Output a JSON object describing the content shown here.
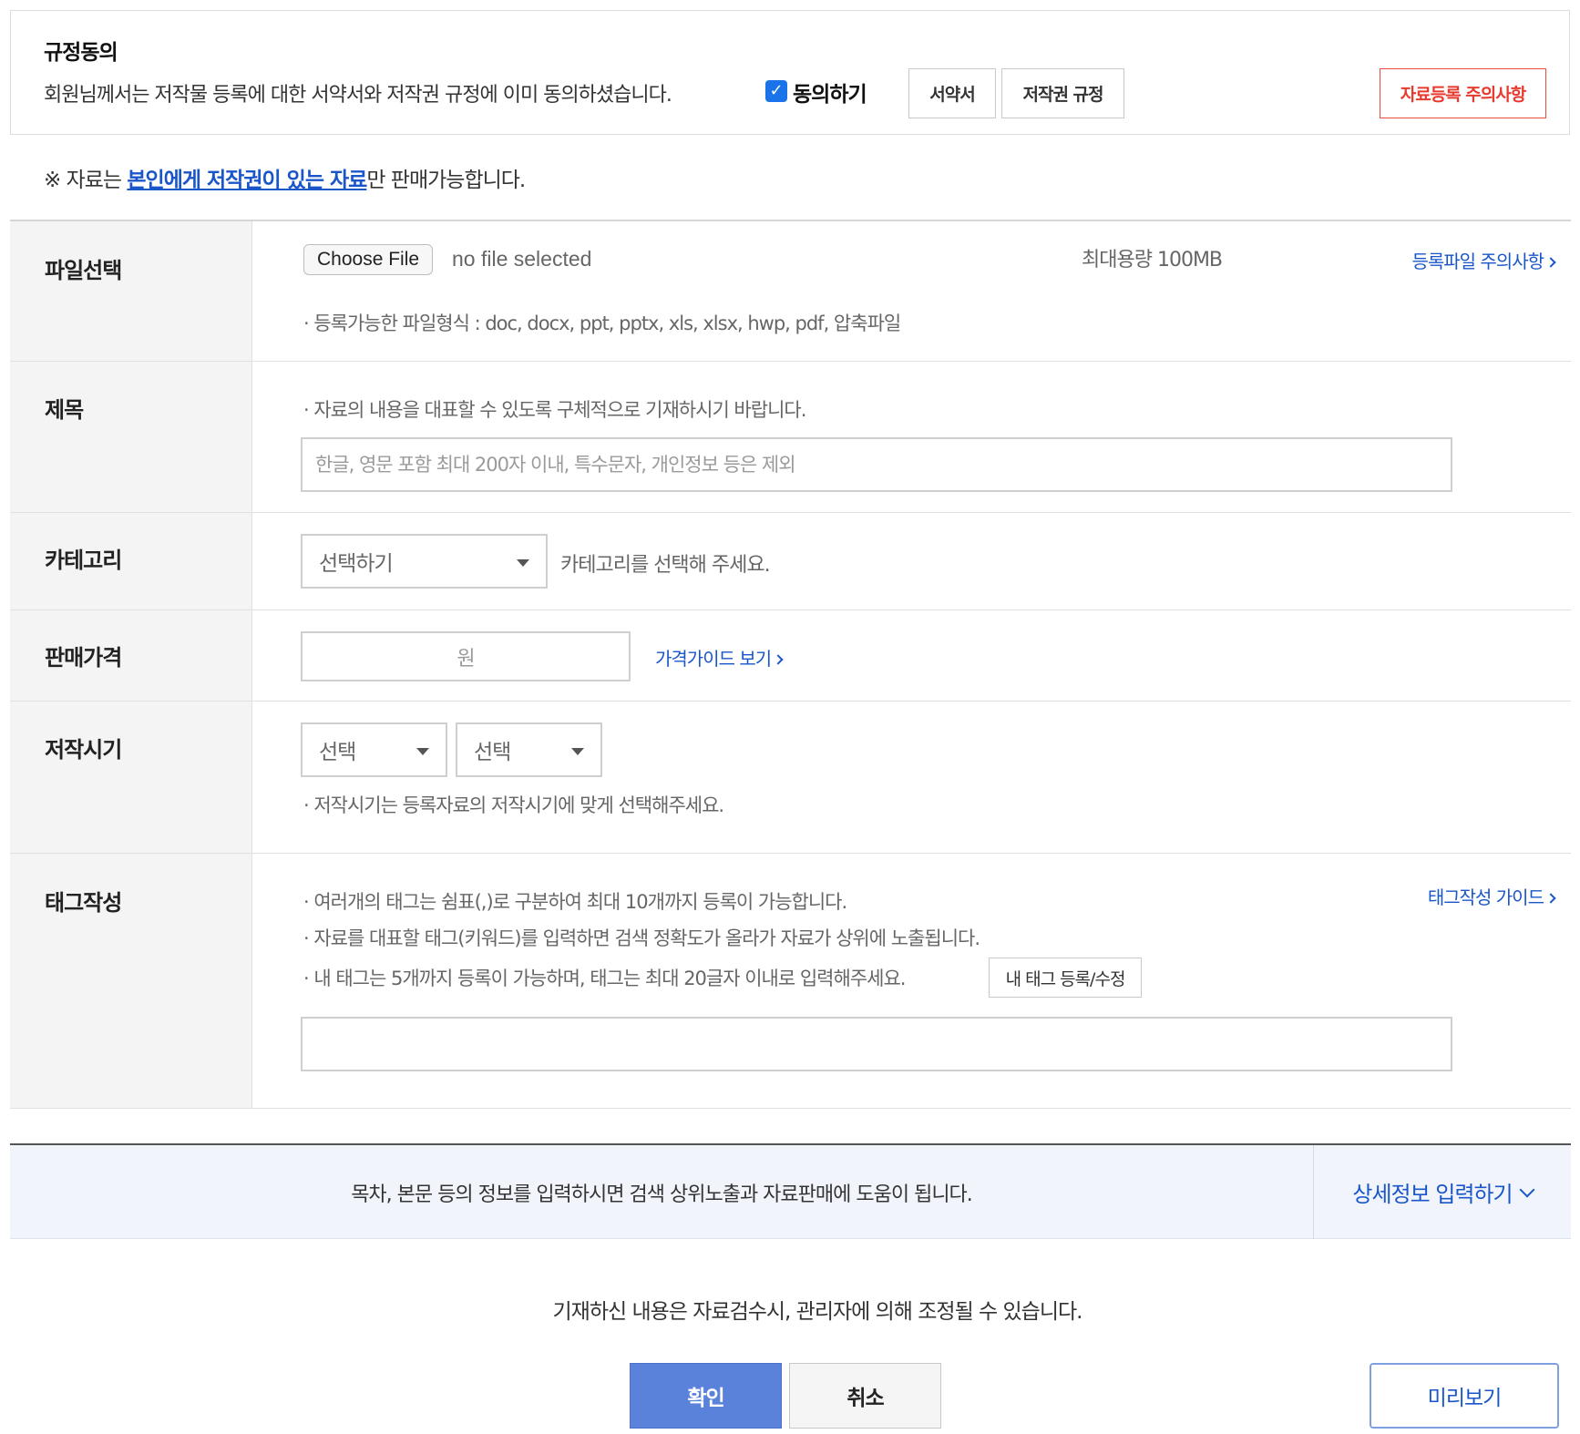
{
  "agreement": {
    "title": "규정동의",
    "text": "회원님께서는 저작물 등록에 대한 서약서와 저작권 규정에 이미 동의하셨습니다.",
    "checkbox_label": "동의하기",
    "checked": true,
    "pledge_button": "서약서",
    "copyright_button": "저작권 규정",
    "notice_button": "자료등록 주의사항"
  },
  "copyright_note": {
    "prefix": "※ 자료는 ",
    "highlight": "본인에게 저작권이 있는 자료",
    "suffix": "만 판매가능합니다."
  },
  "file_row": {
    "label": "파일선택",
    "choose_button": "Choose File",
    "no_file": "no file selected",
    "max_size": "최대용량 100MB",
    "notice_link": "등록파일 주의사항",
    "formats_hint": "· 등록가능한 파일형식 : doc, docx, ppt, pptx, xls, xlsx, hwp, pdf, 압축파일"
  },
  "title_row": {
    "label": "제목",
    "hint": "· 자료의 내용을 대표할 수 있도록 구체적으로 기재하시기 바랍니다.",
    "placeholder": "한글, 영문 포함 최대 200자 이내, 특수문자, 개인정보 등은 제외",
    "value": ""
  },
  "category_row": {
    "label": "카테고리",
    "select_value": "선택하기",
    "hint": "카테고리를 선택해 주세요."
  },
  "price_row": {
    "label": "판매가격",
    "unit": "원",
    "guide_link": "가격가이드 보기"
  },
  "date_row": {
    "label": "저작시기",
    "select1": "선택",
    "select2": "선택",
    "hint": "· 저작시기는 등록자료의 저작시기에 맞게 선택해주세요."
  },
  "tag_row": {
    "label": "태그작성",
    "hints": [
      "· 여러개의 태그는 쉼표(,)로 구분하여 최대 10개까지 등록이 가능합니다.",
      "· 자료를 대표할 태그(키워드)를 입력하면 검색 정확도가 올라가 자료가 상위에 노출됩니다.",
      "· 내 태그는 5개까지 등록이 가능하며, 태그는 최대 20글자 이내로 입력해주세요."
    ],
    "my_tag_button": "내 태그 등록/수정",
    "guide_link": "태그작성 가이드",
    "value": ""
  },
  "detail_banner": {
    "text": "목차, 본문 등의 정보를 입력하시면 검색 상위노출과 자료판매에 도움이 됩니다.",
    "button": "상세정보 입력하기"
  },
  "bottom": {
    "note": "기재하신 내용은 자료검수시, 관리자에 의해 조정될 수 있습니다.",
    "confirm": "확인",
    "cancel": "취소",
    "preview": "미리보기"
  },
  "colors": {
    "accent_blue": "#1a56c9",
    "confirm_bg": "#5a82db",
    "warning_red": "#e63c2f",
    "label_bg": "#f4f4f4",
    "banner_bg": "#f1f5fb"
  }
}
